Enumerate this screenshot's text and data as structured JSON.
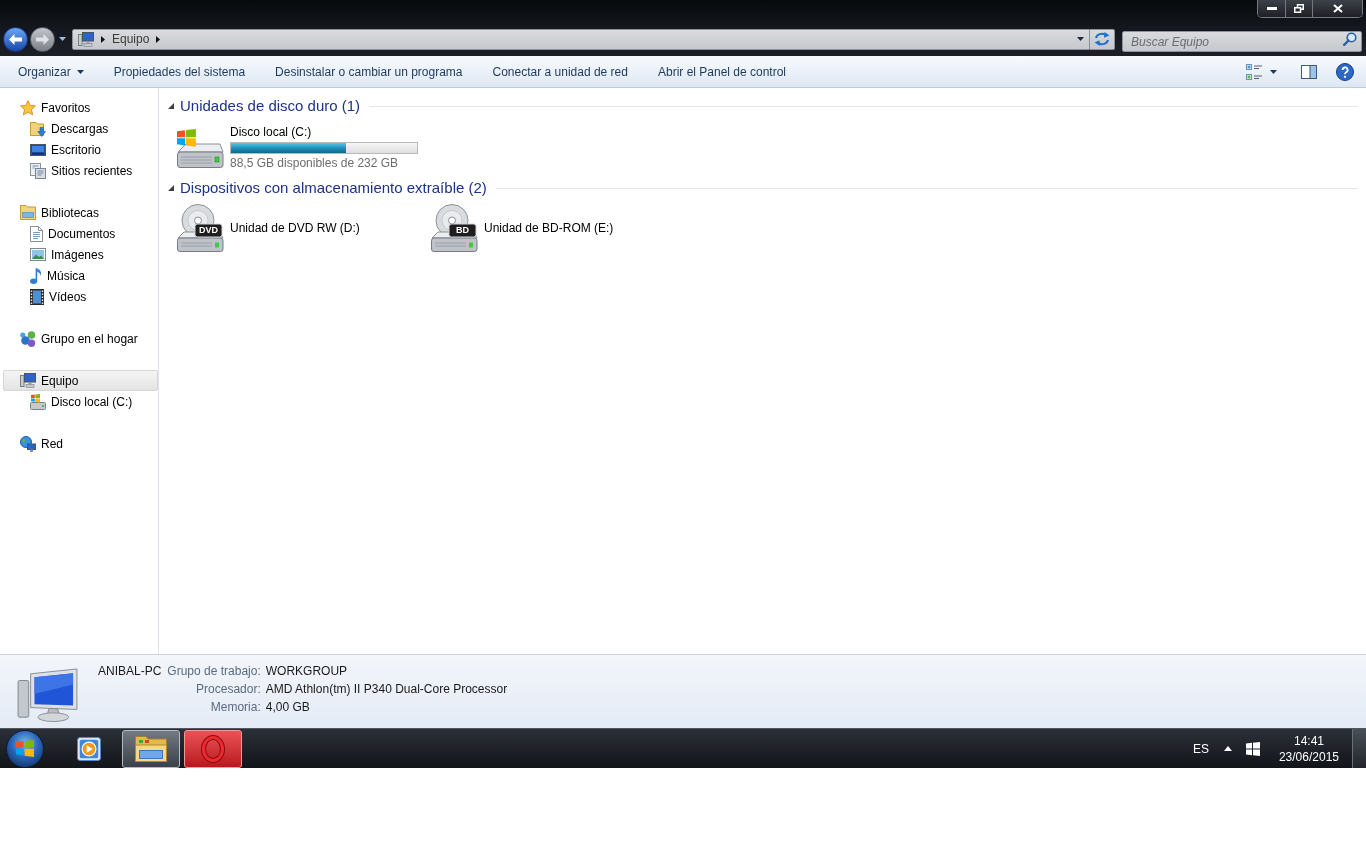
{
  "navigation": {
    "back": {
      "disabled": false
    },
    "forward": {
      "disabled": true
    },
    "breadcrumb": [
      "Equipo"
    ],
    "search": {
      "placeholder": "Buscar Equipo"
    }
  },
  "toolbar": {
    "buttons": [
      {
        "label": "Organizar",
        "kind": "menu"
      },
      {
        "label": "Propiedades del sistema",
        "kind": "command"
      },
      {
        "label": "Desinstalar o cambiar un programa",
        "kind": "command"
      },
      {
        "label": "Conectar a unidad de red",
        "kind": "command"
      },
      {
        "label": "Abrir el Panel de control",
        "kind": "command"
      }
    ]
  },
  "sidebar": {
    "groups": [
      {
        "label": "Favoritos",
        "selected": false,
        "children": [
          {
            "label": "Descargas",
            "selected": false
          },
          {
            "label": "Escritorio",
            "selected": false
          },
          {
            "label": "Sitios recientes",
            "selected": false
          }
        ]
      },
      {
        "label": "Bibliotecas",
        "selected": false,
        "children": [
          {
            "label": "Documentos",
            "selected": false
          },
          {
            "label": "Imágenes",
            "selected": false
          },
          {
            "label": "Música",
            "selected": false
          },
          {
            "label": "Vídeos",
            "selected": false
          }
        ]
      },
      {
        "label": "Grupo en el hogar",
        "selected": false
      },
      {
        "label": "Equipo",
        "selected": true,
        "children": [
          {
            "label": "Disco local (C:)",
            "selected": false
          }
        ]
      },
      {
        "label": "Red",
        "selected": false
      }
    ]
  },
  "content": {
    "groups": [
      {
        "title": "Unidades de disco duro (1)",
        "expanded": true,
        "items": [
          {
            "kind": "hdd",
            "name": "Disco local (C:)",
            "level": 0.62,
            "reading": "88,5 GB disponibles de 232 GB"
          }
        ]
      },
      {
        "title": "Dispositivos con almacenamiento extraíble (2)",
        "expanded": true,
        "items": [
          {
            "kind": "optical",
            "name": "Unidad de DVD RW (D:)",
            "disc_label": "DVD"
          },
          {
            "kind": "optical",
            "name": "Unidad de BD-ROM (E:)",
            "disc_label": "BD"
          }
        ]
      }
    ]
  },
  "details": {
    "name": "ANIBAL-PC",
    "fields": [
      {
        "label": "Grupo de trabajo:",
        "value": "WORKGROUP"
      },
      {
        "label": "Procesador:",
        "value": "AMD Athlon(tm) II P340 Dual-Core Processor"
      },
      {
        "label": "Memoria:",
        "value": "4,00 GB"
      }
    ]
  },
  "taskbar": {
    "apps": [
      {
        "running": false,
        "selected": false,
        "hovered": false
      },
      {
        "running": true,
        "selected": true,
        "hovered": false
      },
      {
        "running": true,
        "selected": false,
        "hovered": true
      }
    ],
    "language": "ES",
    "time": "14:41",
    "date": "23/06/2015"
  }
}
